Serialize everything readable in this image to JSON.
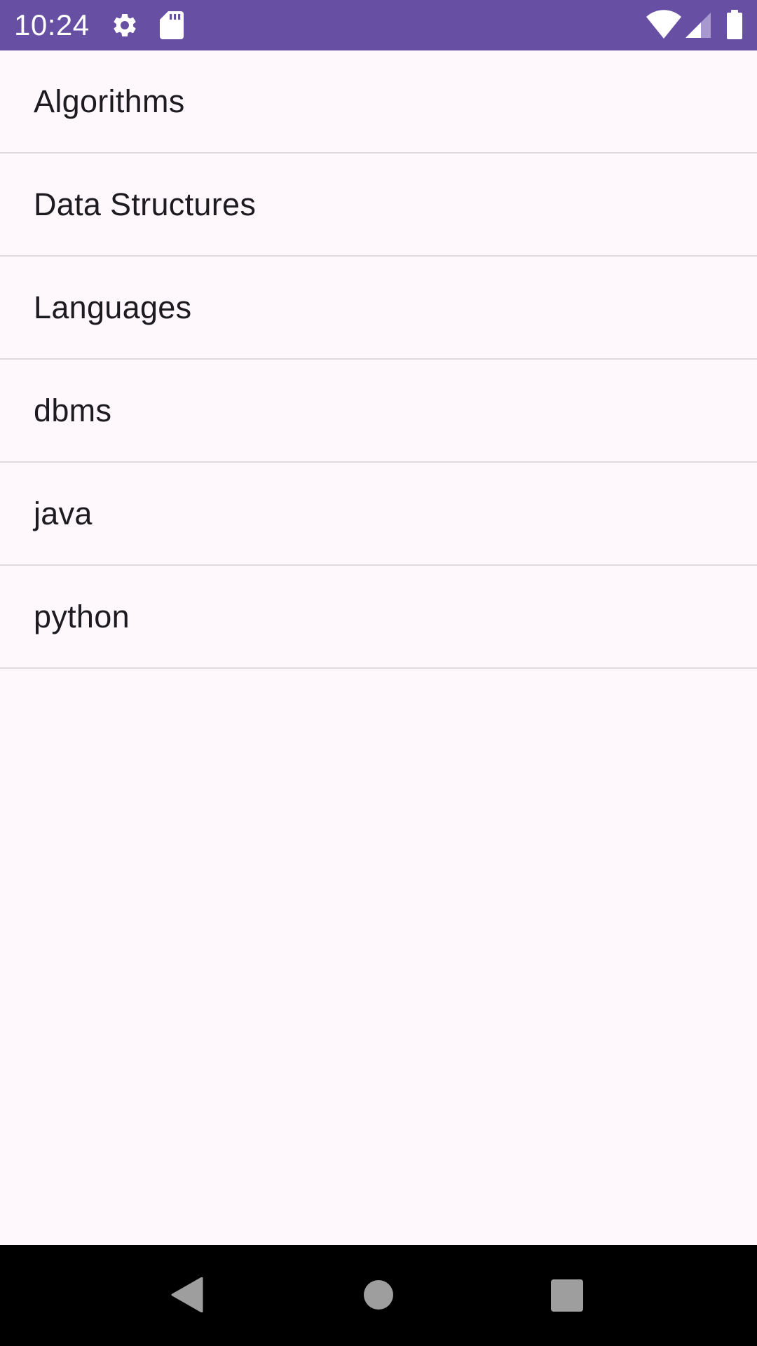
{
  "status_bar": {
    "time": "10:24",
    "left_icons": [
      "gear-icon",
      "sd-card-icon"
    ],
    "right_icons": [
      "wifi-icon",
      "cell-signal-icon",
      "battery-icon"
    ],
    "background": "#6750A4"
  },
  "list": {
    "items": [
      {
        "label": "Algorithms"
      },
      {
        "label": "Data Structures"
      },
      {
        "label": "Languages"
      },
      {
        "label": "dbms"
      },
      {
        "label": "java"
      },
      {
        "label": "python"
      }
    ]
  },
  "nav_bar": {
    "buttons": [
      "back-icon",
      "home-icon",
      "recents-icon"
    ],
    "background": "#000000",
    "button_color": "#9E9E9E"
  }
}
